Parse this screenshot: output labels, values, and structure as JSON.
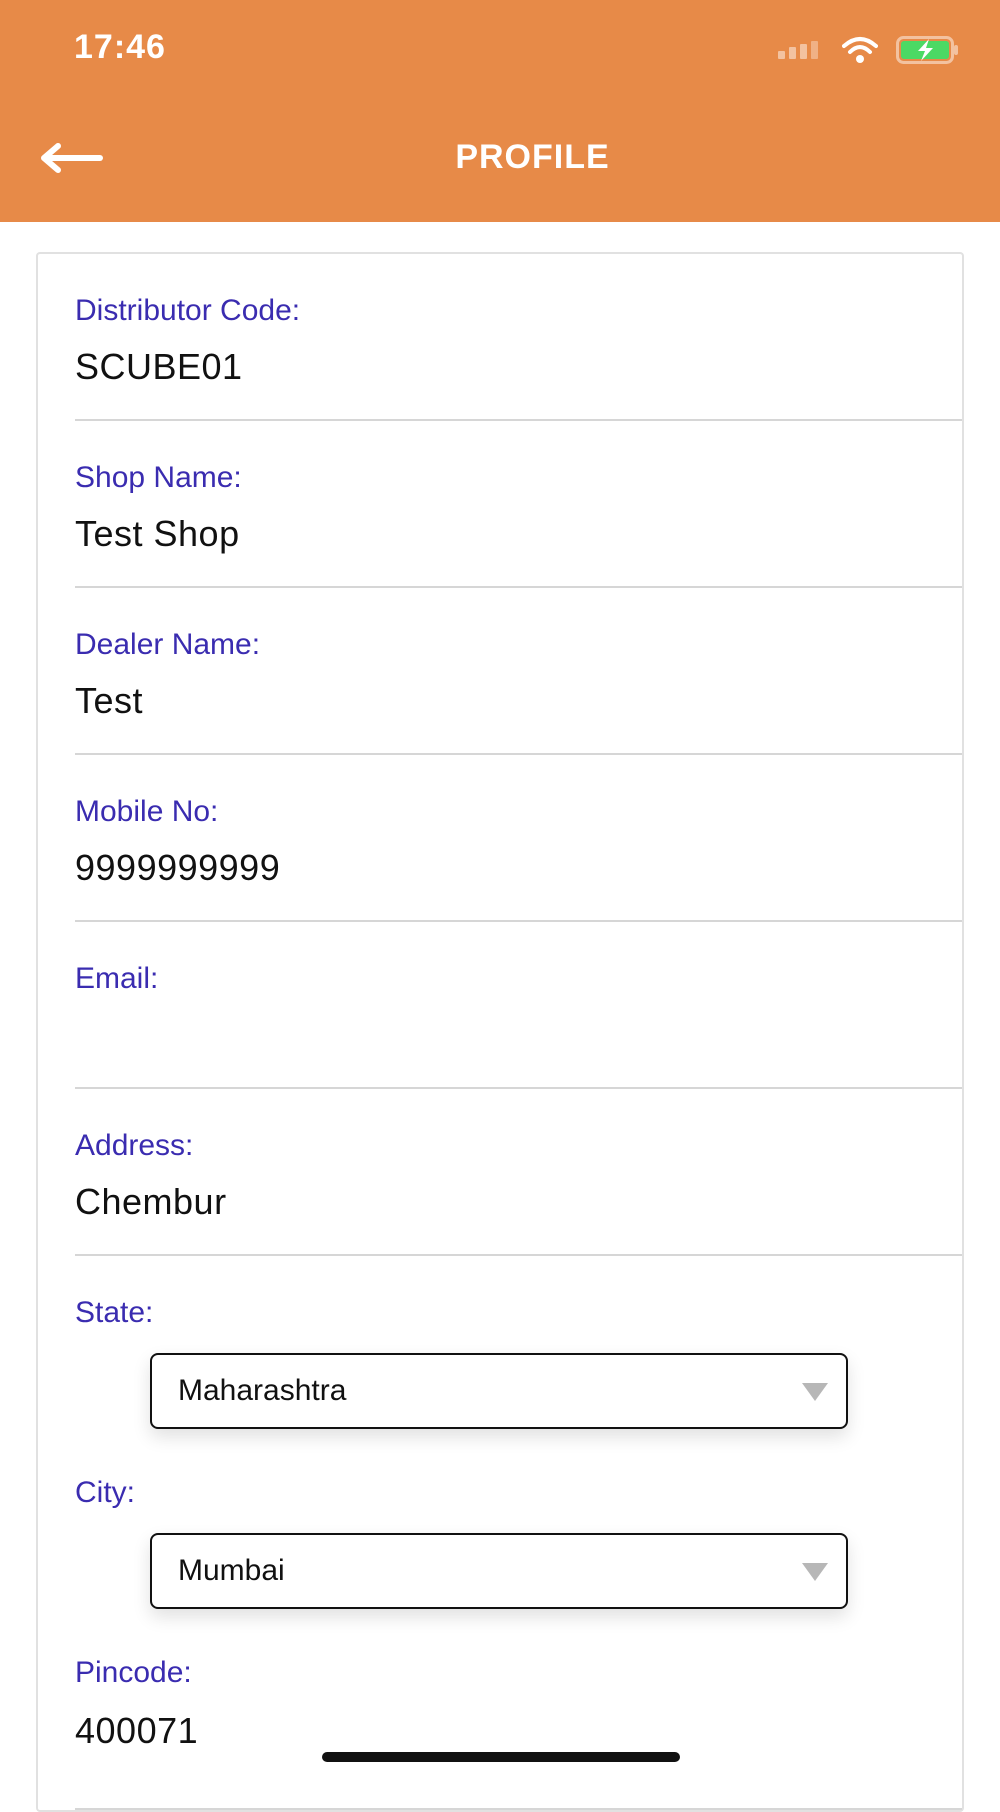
{
  "status_bar": {
    "time": "17:46"
  },
  "header": {
    "title": "PROFILE"
  },
  "fields": [
    {
      "label": "Distributor Code:",
      "value": "SCUBE01"
    },
    {
      "label": "Shop Name:",
      "value": "Test Shop"
    },
    {
      "label": "Dealer Name:",
      "value": "Test"
    },
    {
      "label": "Mobile No:",
      "value": "9999999999"
    },
    {
      "label": "Email:",
      "value": ""
    },
    {
      "label": "Address:",
      "value": "Chembur"
    }
  ],
  "state": {
    "label": "State:",
    "selected": "Maharashtra"
  },
  "city": {
    "label": "City:",
    "selected": "Mumbai"
  },
  "pincode": {
    "label": "Pincode:",
    "value": "400071"
  },
  "colors": {
    "header": "#E78A48",
    "label": "#3a2cb0",
    "battery": "#4cd964"
  },
  "icons": [
    "signal-icon",
    "wifi-icon",
    "battery-charging-icon",
    "back-arrow-icon",
    "dropdown-arrow-icon"
  ]
}
